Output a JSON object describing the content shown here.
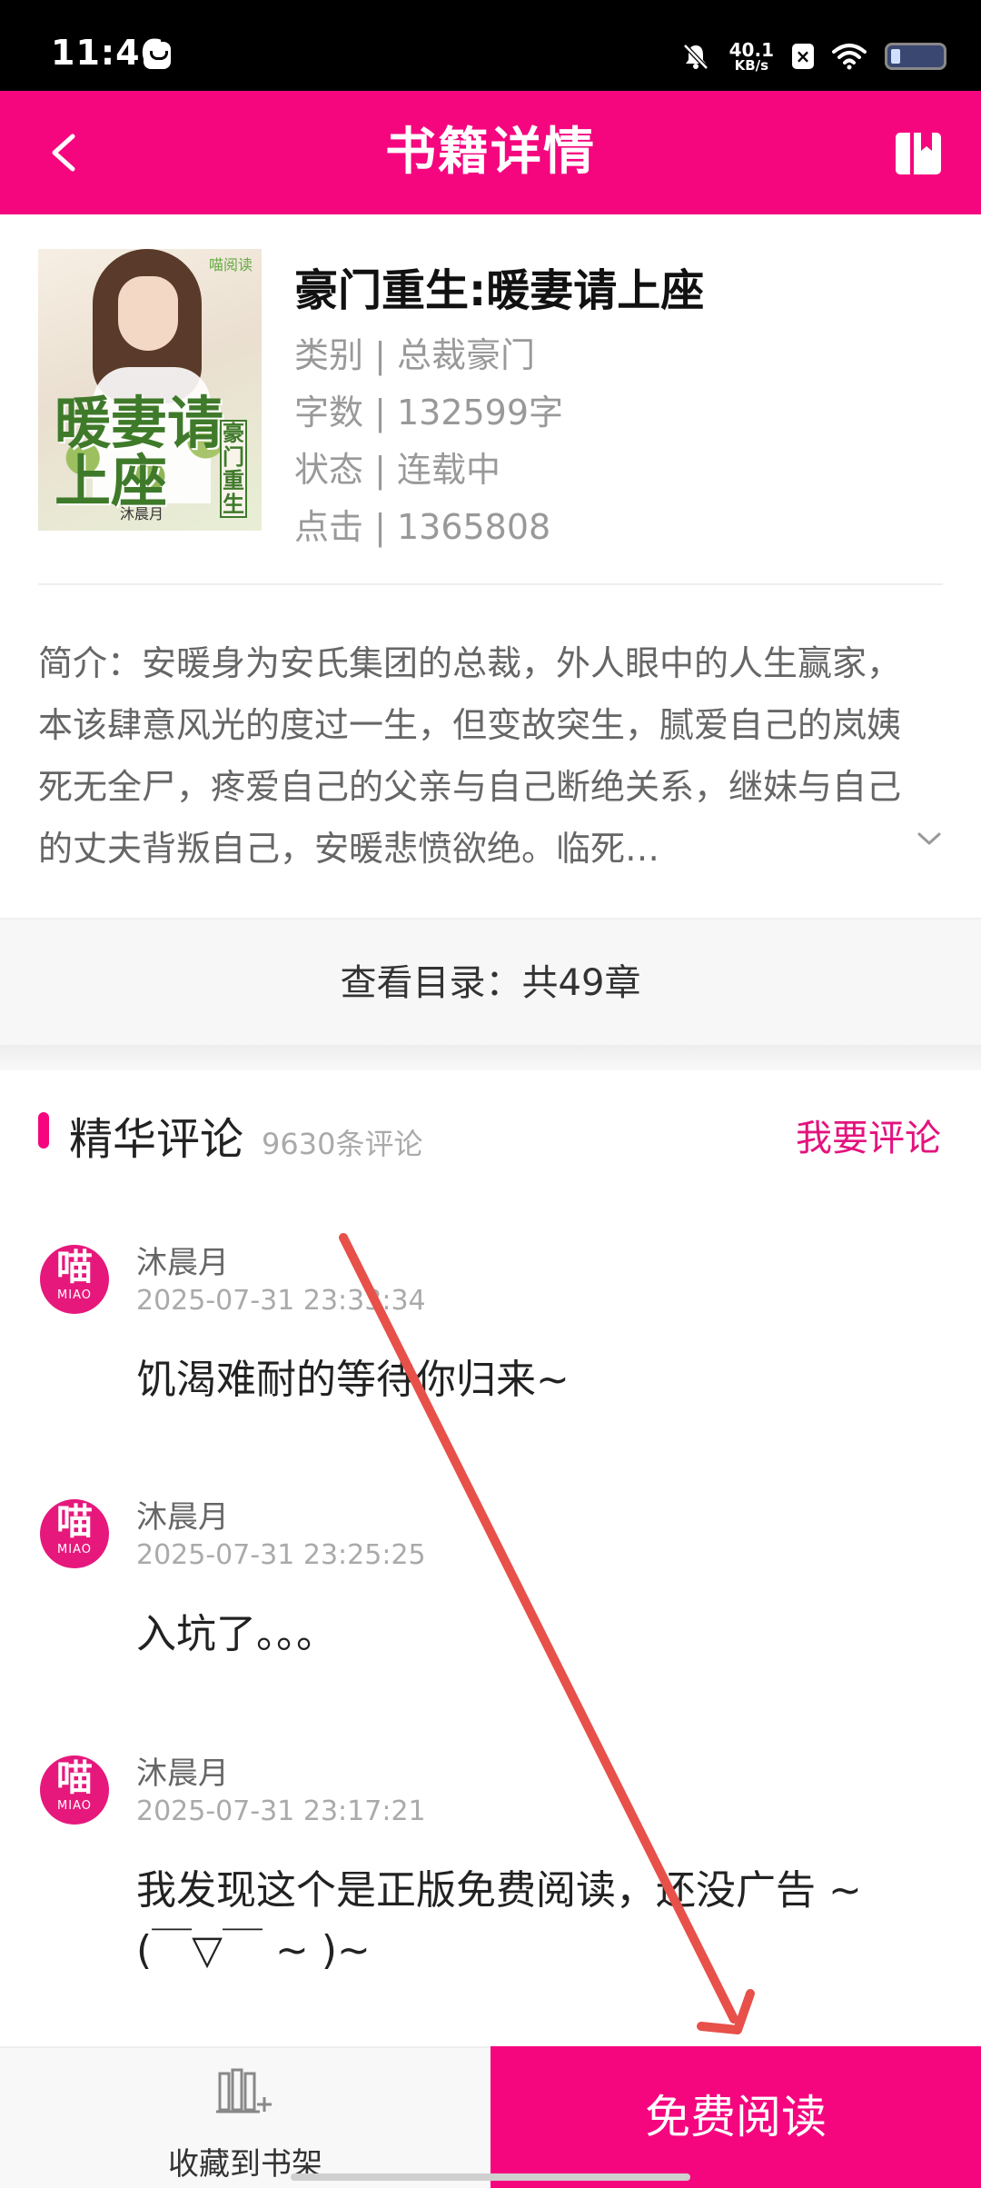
{
  "status_bar": {
    "time": "11:46",
    "net_speed_value": "40.1",
    "net_speed_unit": "KB/s"
  },
  "nav": {
    "title": "书籍详情",
    "back_icon": "chevron-left-icon",
    "bookshelf_icon": "bookshelf-icon"
  },
  "book": {
    "cover_text": {
      "publisher": "喵阅读",
      "title": "暖妻请上座",
      "subtitle": "豪门重生",
      "author": "沐晨月"
    },
    "title": "豪门重生:暖妻请上座",
    "category": "类别 | 总裁豪门",
    "word_count": "字数 | 132599字",
    "status": "状态 | 连载中",
    "clicks": "点击 | 1365808",
    "synopsis": "简介：安暖身为安氏集团的总裁，外人眼中的人生赢家，本该肆意风光的度过一生，但变故突生，腻爱自己的岚姨死无全尸，疼爱自己的父亲与自己断绝关系，继妹与自己的丈夫背叛自己，安暖悲愤欲绝。临死…"
  },
  "toc": {
    "label": "查看目录：共49章"
  },
  "comments": {
    "title": "精华评论",
    "count": "9630条评论",
    "write_label": "我要评论",
    "avatar_text": "喵",
    "avatar_sub": "MIAO",
    "items": [
      {
        "name": "沐晨月",
        "time": "2025-07-31 23:33:34",
        "text": "饥渴难耐的等待你归来~"
      },
      {
        "name": "沐晨月",
        "time": "2025-07-31 23:25:25",
        "text": "入坑了。。。"
      },
      {
        "name": "沐晨月",
        "time": "2025-07-31 23:17:21",
        "text": "我发现这个是正版免费阅读，还没广告 ~ (￣▽￣ ~ )~"
      }
    ]
  },
  "bottom": {
    "shelf_label": "收藏到书架",
    "read_label": "免费阅读"
  },
  "colors": {
    "brand": "#f5067f",
    "annotation_arrow": "#e8504a"
  }
}
